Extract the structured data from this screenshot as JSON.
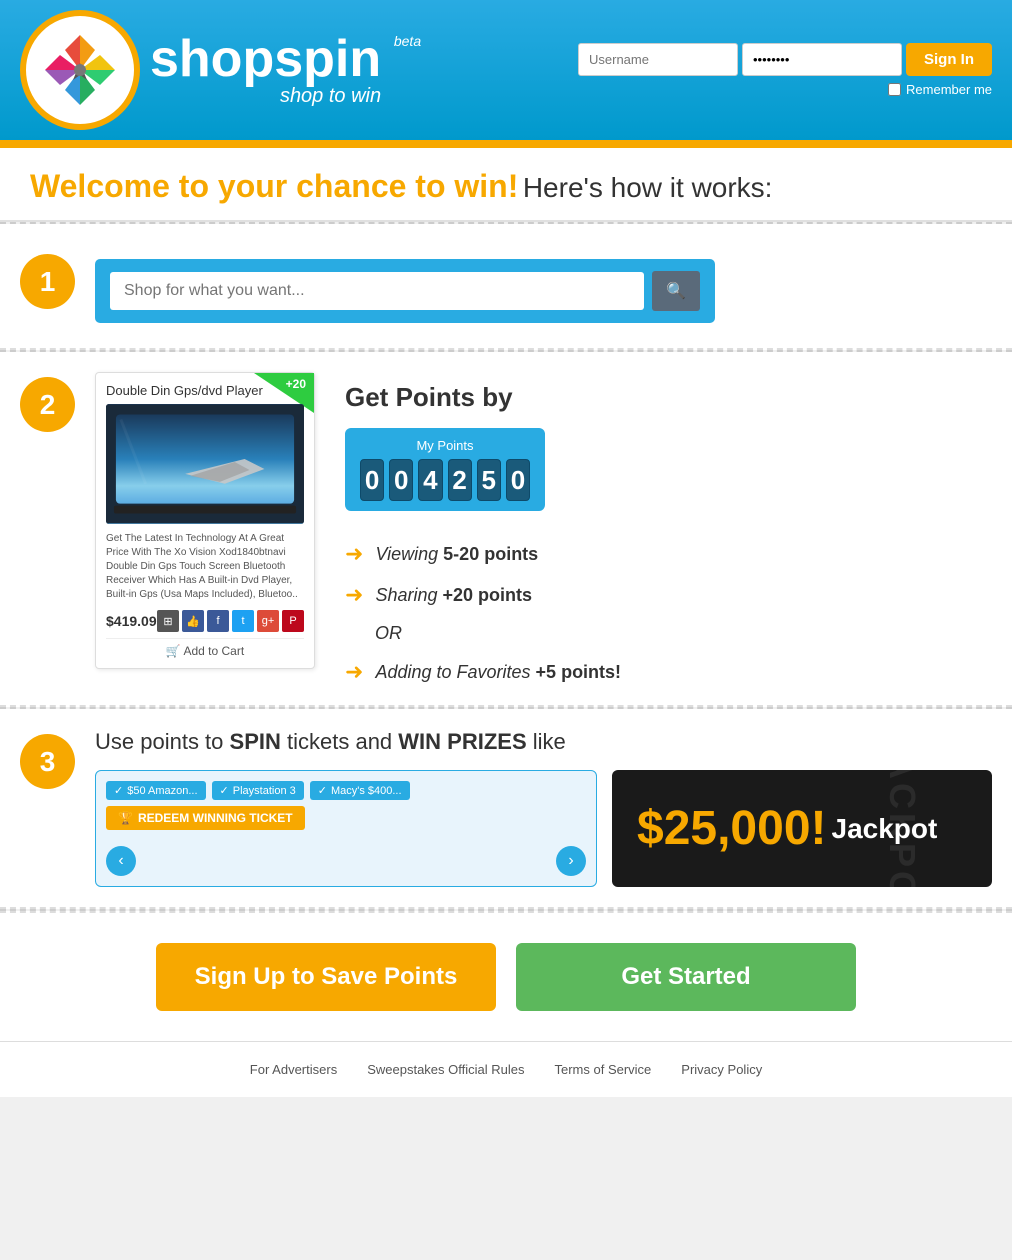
{
  "header": {
    "logo_text": "shopspin",
    "logo_beta": "beta",
    "logo_tagline": "shop to win",
    "username_placeholder": "Username",
    "password_value": "••••••••",
    "signin_label": "Sign In",
    "remember_me_label": "Remember me"
  },
  "welcome": {
    "title_orange": "Welcome to your chance to win!",
    "title_black": " Here's how it works:"
  },
  "step1": {
    "number": "1",
    "search_placeholder": "Shop for what you want..."
  },
  "step2": {
    "number": "2",
    "product": {
      "badge": "+20",
      "title": "Double Din Gps/dvd Player",
      "description": "Get The Latest In Technology At A Great Price With The Xo Vision Xod1840btnavi Double Din Gps Touch Screen Bluetooth Receiver Which Has A Built-in Dvd Player, Built-in Gps (Usa Maps Included), Bluetoo..",
      "price": "$419.09",
      "add_to_cart": "Add to Cart"
    },
    "get_points_title": "Get Points",
    "get_points_by": " by",
    "my_points_label": "My Points",
    "digits": [
      "0",
      "0",
      "4",
      "2",
      "5",
      "0"
    ],
    "actions": [
      {
        "text_italic": "Viewing",
        "text_bold": "5-20 points"
      },
      {
        "text_italic": "Sharing",
        "text_bold": "+20 points"
      },
      {
        "text_italic": "Adding to Favorites",
        "text_bold": "+5 points!"
      }
    ],
    "or_text": "OR"
  },
  "step3": {
    "number": "3",
    "title_normal": "Use points to ",
    "title_bold1": "SPIN",
    "title_mid": " tickets and ",
    "title_bold2": "WIN PRIZES",
    "title_end": " like",
    "tags": [
      "$50 Amazon...",
      "Playstation 3",
      "Macy's $400..."
    ],
    "redeem_label": "REDEEM WINNING TICKET",
    "jackpot_amount": "$25,000!",
    "jackpot_label": "Jackpot",
    "jackpot_watermark": "JACKPOT"
  },
  "cta": {
    "signup_label": "Sign Up to Save Points",
    "getstarted_label": "Get Started"
  },
  "footer": {
    "links": [
      "For Advertisers",
      "Sweepstakes Official Rules",
      "Terms of Service",
      "Privacy Policy"
    ]
  }
}
